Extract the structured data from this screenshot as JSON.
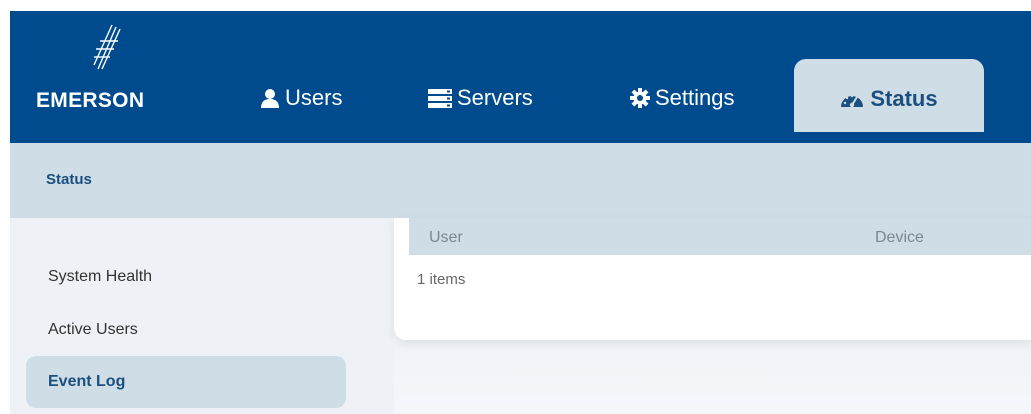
{
  "brand": {
    "name": "EMERSON"
  },
  "nav": {
    "users": {
      "label": "Users",
      "icon": "user-icon"
    },
    "servers": {
      "label": "Servers",
      "icon": "server-icon"
    },
    "settings": {
      "label": "Settings",
      "icon": "gear-icon"
    },
    "status": {
      "label": "Status",
      "icon": "dashboard-gauge-icon",
      "active": true
    }
  },
  "breadcrumb": "Status",
  "sidebar": {
    "items": [
      {
        "label": "System Health",
        "active": false
      },
      {
        "label": "Active Users",
        "active": false
      },
      {
        "label": "Event Log",
        "active": true
      }
    ]
  },
  "table": {
    "columns": [
      "User",
      "Device"
    ],
    "items_count": "1 items"
  },
  "colors": {
    "topbar": "#004b8d",
    "accent_light": "#cfdde6",
    "accent_text": "#1b4f80"
  }
}
